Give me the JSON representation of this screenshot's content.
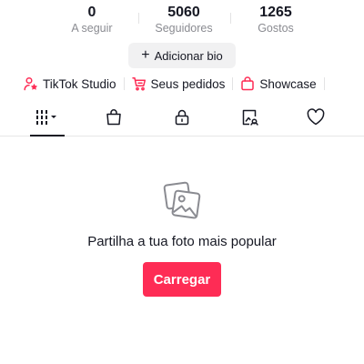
{
  "stats": [
    {
      "value": "0",
      "label": "A seguir"
    },
    {
      "value": "5060",
      "label": "Seguidores"
    },
    {
      "value": "1265",
      "label": "Gostos"
    }
  ],
  "bio_button": {
    "icon": "plus-icon",
    "label": "Adicionar bio"
  },
  "shortcuts": [
    {
      "icon": "person-star-icon",
      "label": "TikTok Studio"
    },
    {
      "icon": "cart-icon",
      "label": "Seus pedidos"
    },
    {
      "icon": "shopping-bag-icon",
      "label": "Showcase"
    }
  ],
  "tabs": [
    {
      "icon": "grid-icon",
      "active": true
    },
    {
      "icon": "shop-bag-icon",
      "active": false
    },
    {
      "icon": "lock-icon",
      "active": false
    },
    {
      "icon": "tagged-icon",
      "active": false
    },
    {
      "icon": "heart-icon",
      "active": false
    }
  ],
  "empty_state": {
    "icon": "photos-icon",
    "message": "Partilha a tua foto mais popular",
    "button_label": "Carregar"
  },
  "colors": {
    "accent": "#fe2c55",
    "text": "#161823",
    "muted": "#8a8b91",
    "chip_bg": "#f1f1f2"
  }
}
